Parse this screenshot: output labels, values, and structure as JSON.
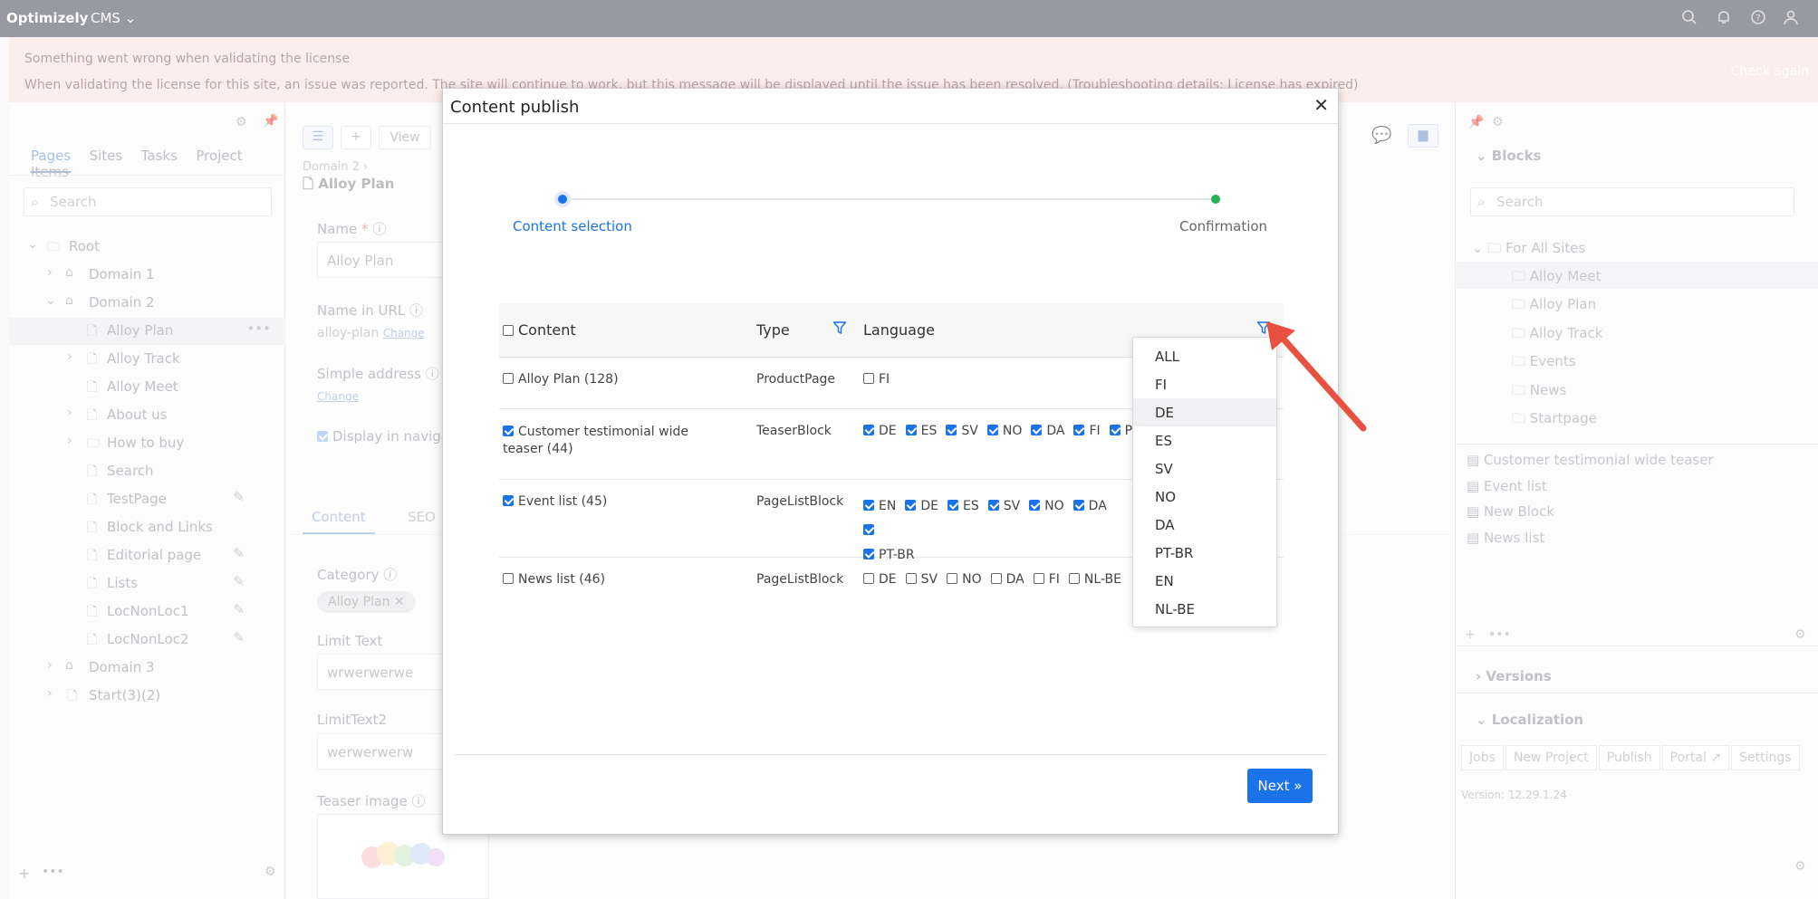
{
  "topbar": {
    "brand": "Optimizely",
    "product": "CMS"
  },
  "banner": {
    "title": "Something went wrong when validating the license",
    "message": "When validating the license for this site, an issue was reported. The site will continue to work, but this message will be displayed until the issue has been resolved. (Troubleshooting details: License has expired)",
    "action": "Check again"
  },
  "left": {
    "tabs": [
      "Pages",
      "Sites",
      "Tasks",
      "Project Items"
    ],
    "search_placeholder": "Search",
    "tree": [
      {
        "label": "Root"
      },
      {
        "label": "Domain 1"
      },
      {
        "label": "Domain 2"
      },
      {
        "label": "Alloy Plan"
      },
      {
        "label": "Alloy Track"
      },
      {
        "label": "Alloy Meet"
      },
      {
        "label": "About us"
      },
      {
        "label": "How to buy"
      },
      {
        "label": "Search"
      },
      {
        "label": "TestPage"
      },
      {
        "label": "Block and Links"
      },
      {
        "label": "Editorial page"
      },
      {
        "label": "Lists"
      },
      {
        "label": "LocNonLoc1"
      },
      {
        "label": "LocNonLoc2"
      },
      {
        "label": "Domain 3"
      },
      {
        "label": "Start(3)(2)"
      }
    ]
  },
  "middle": {
    "toolbar_view": "View",
    "breadcrumb": "Domain 2",
    "page_title": "Alloy Plan",
    "name_label": "Name",
    "name_value": "Alloy Plan",
    "url_label": "Name in URL",
    "url_value": "alloy-plan",
    "change": "Change",
    "simple_label": "Simple address",
    "display_nav": "Display in navigati",
    "tab_content": "Content",
    "tab_seo": "SEO",
    "category_label": "Category",
    "category_tag": "Alloy Plan",
    "limit_label": "Limit Text",
    "limit_value": "wrwerwerwe",
    "limit2_label": "LimitText2",
    "limit2_value": "werwerwerw",
    "teaser_label": "Teaser image"
  },
  "right": {
    "blocks_title": "Blocks",
    "search_placeholder": "Search",
    "folder": "For All Sites",
    "folders": [
      "Alloy Meet",
      "Alloy Plan",
      "Alloy Track",
      "Events",
      "News",
      "Startpage"
    ],
    "blocks": [
      "Customer testimonial wide teaser",
      "Event list",
      "New Block",
      "News list"
    ],
    "versions": "Versions",
    "localization": "Localization",
    "loc_buttons": [
      "Jobs",
      "New Project",
      "Publish",
      "Portal",
      "Settings"
    ],
    "version": "Version: 12.29.1.24"
  },
  "modal": {
    "title": "Content publish",
    "steps": [
      "Content selection",
      "Confirmation"
    ],
    "columns": {
      "content": "Content",
      "type": "Type",
      "language": "Language"
    },
    "rows": [
      {
        "name": "Alloy Plan (128)",
        "checked": false,
        "type": "ProductPage",
        "langs": [
          {
            "code": "FI",
            "on": false
          }
        ]
      },
      {
        "name": "Customer testimonial wide teaser (44)",
        "checked": true,
        "type": "TeaserBlock",
        "langs": [
          {
            "code": "DE",
            "on": true
          },
          {
            "code": "ES",
            "on": true
          },
          {
            "code": "SV",
            "on": true
          },
          {
            "code": "NO",
            "on": true
          },
          {
            "code": "DA",
            "on": true
          },
          {
            "code": "FI",
            "on": true
          },
          {
            "code": "P",
            "on": true
          }
        ]
      },
      {
        "name": "Event list (45)",
        "checked": true,
        "type": "PageListBlock",
        "langs": [
          {
            "code": "EN",
            "on": true
          },
          {
            "code": "DE",
            "on": true
          },
          {
            "code": "ES",
            "on": true
          },
          {
            "code": "SV",
            "on": true
          },
          {
            "code": "NO",
            "on": true
          },
          {
            "code": "DA",
            "on": true
          },
          {
            "code": "",
            "on": true
          },
          {
            "code": "PT-BR",
            "on": true
          }
        ]
      },
      {
        "name": "News list (46)",
        "checked": false,
        "type": "PageListBlock",
        "langs": [
          {
            "code": "DE",
            "on": false
          },
          {
            "code": "SV",
            "on": false
          },
          {
            "code": "NO",
            "on": false
          },
          {
            "code": "DA",
            "on": false
          },
          {
            "code": "FI",
            "on": false
          },
          {
            "code": "NL-BE",
            "on": false
          }
        ]
      }
    ],
    "next_label": "Next »",
    "dropdown": [
      "ALL",
      "FI",
      "DE",
      "ES",
      "SV",
      "NO",
      "DA",
      "PT-BR",
      "EN",
      "NL-BE"
    ],
    "dropdown_highlight": "DE"
  },
  "colors": {
    "accent": "#1a73e8",
    "arrow": "#e8513f",
    "confirm_dot": "#22b14c"
  }
}
